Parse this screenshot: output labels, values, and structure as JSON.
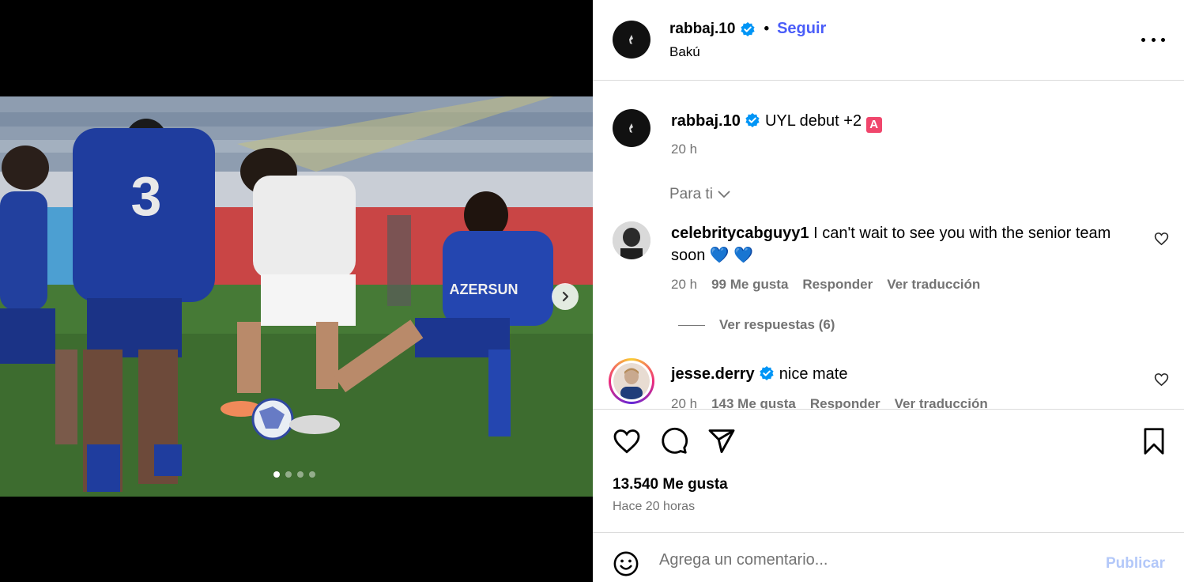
{
  "header": {
    "username": "rabbaj.10",
    "separator": "•",
    "follow_label": "Seguir",
    "location": "Bakú"
  },
  "caption": {
    "username": "rabbaj.10",
    "text": "UYL debut +2",
    "badge": "A",
    "time": "20 h"
  },
  "for_you_label": "Para ti",
  "comments": [
    {
      "username": "celebritycabguyy1",
      "text_line1": "I can't wait to see you with the senior team",
      "text_line2": "soon 💙 💙",
      "time": "20 h",
      "likes": "99 Me gusta",
      "reply_label": "Responder",
      "translate_label": "Ver traducción",
      "view_replies": "Ver respuestas (6)"
    },
    {
      "username": "jesse.derry",
      "text": "nice mate",
      "time": "20 h",
      "likes": "143 Me gusta",
      "reply_label": "Responder",
      "translate_label": "Ver traducción"
    }
  ],
  "likes_total": "13.540 Me gusta",
  "posted_ago": "Hace 20 horas",
  "composer": {
    "placeholder": "Agrega un comentario...",
    "publish_label": "Publicar"
  },
  "carousel": {
    "total": 4,
    "active": 1
  },
  "colors": {
    "accent": "#4a5df9",
    "verified": "#0095f6",
    "muted": "#737373",
    "publish_disabled": "#b3c8f9"
  }
}
